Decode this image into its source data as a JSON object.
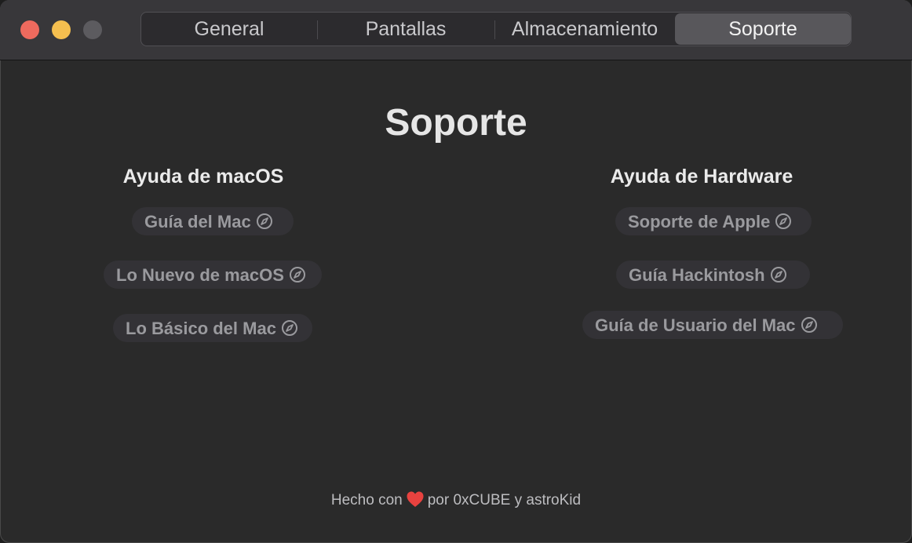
{
  "window": {
    "controls": [
      "close",
      "minimize",
      "zoom"
    ]
  },
  "tabs": [
    {
      "label": "General",
      "selected": false
    },
    {
      "label": "Pantallas",
      "selected": false
    },
    {
      "label": "Almacenamiento",
      "selected": false
    },
    {
      "label": "Soporte",
      "selected": true
    }
  ],
  "main": {
    "title": "Soporte",
    "left_column": {
      "title": "Ayuda de macOS",
      "links": [
        {
          "label": "Guía del Mac",
          "icon": "compass-icon"
        },
        {
          "label": "Lo Nuevo de macOS",
          "icon": "compass-icon"
        },
        {
          "label": "Lo Básico del Mac",
          "icon": "compass-icon"
        }
      ]
    },
    "right_column": {
      "title": "Ayuda de Hardware",
      "links": [
        {
          "label": "Soporte de Apple",
          "icon": "compass-icon"
        },
        {
          "label": "Guía Hackintosh",
          "icon": "compass-icon"
        },
        {
          "label": "Guía de Usuario del Mac",
          "icon": "compass-icon"
        }
      ]
    }
  },
  "footer": {
    "prefix": "Hecho con",
    "icon": "heart-icon",
    "suffix": "por 0xCUBE y astroKid"
  },
  "colors": {
    "close": "#ee6a5e",
    "minimize": "#f5bf4f",
    "zoom_disabled": "#5c5b5f",
    "heart": "#e8423f"
  }
}
